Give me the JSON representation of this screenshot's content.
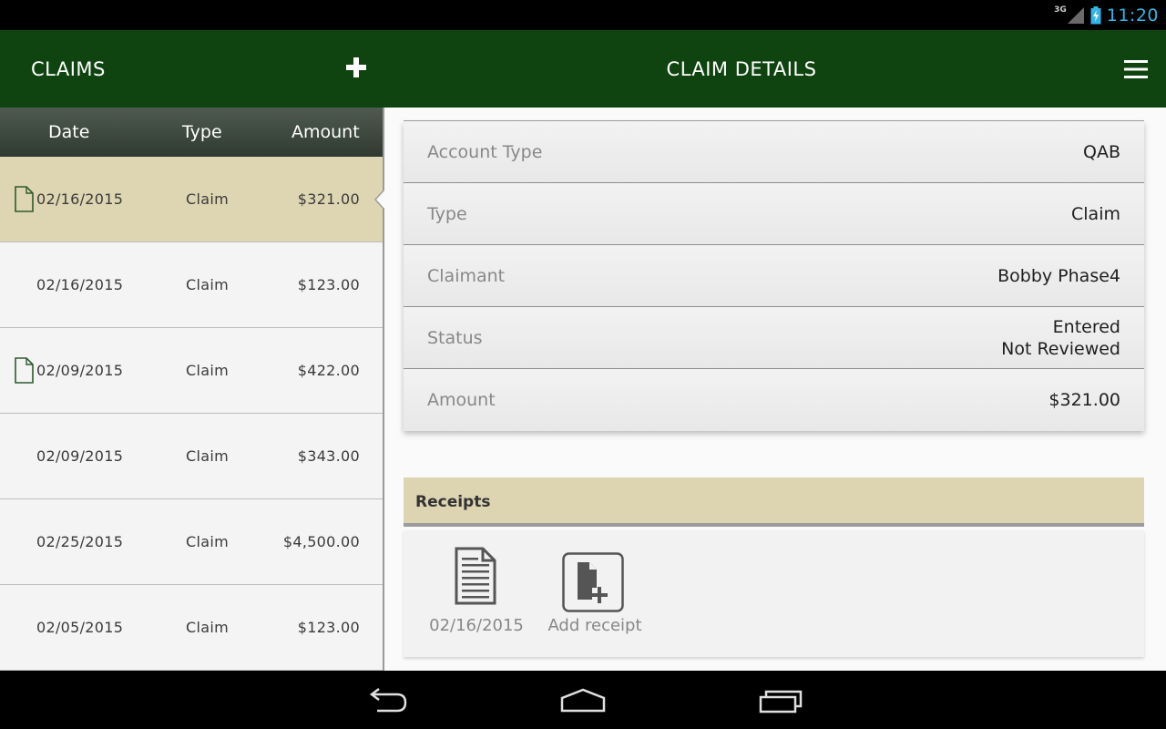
{
  "status_bar": {
    "network": "3G",
    "time": "11:20"
  },
  "action_bar": {
    "left_title": "CLAIMS",
    "center_title": "CLAIM DETAILS"
  },
  "claims_list": {
    "headers": {
      "date": "Date",
      "type": "Type",
      "amount": "Amount"
    },
    "rows": [
      {
        "date": "02/16/2015",
        "type": "Claim",
        "amount": "$321.00",
        "has_doc": true,
        "selected": true
      },
      {
        "date": "02/16/2015",
        "type": "Claim",
        "amount": "$123.00",
        "has_doc": false,
        "selected": false
      },
      {
        "date": "02/09/2015",
        "type": "Claim",
        "amount": "$422.00",
        "has_doc": true,
        "selected": false
      },
      {
        "date": "02/09/2015",
        "type": "Claim",
        "amount": "$343.00",
        "has_doc": false,
        "selected": false
      },
      {
        "date": "02/25/2015",
        "type": "Claim",
        "amount": "$4,500.00",
        "has_doc": false,
        "selected": false
      },
      {
        "date": "02/05/2015",
        "type": "Claim",
        "amount": "$123.00",
        "has_doc": false,
        "selected": false
      }
    ]
  },
  "details": {
    "account_type": {
      "label": "Account Type",
      "value": "QAB"
    },
    "type": {
      "label": "Type",
      "value": "Claim"
    },
    "claimant": {
      "label": "Claimant",
      "value": "Bobby Phase4"
    },
    "status": {
      "label": "Status",
      "value_line1": "Entered",
      "value_line2": "Not Reviewed"
    },
    "amount": {
      "label": "Amount",
      "value": "$321.00"
    }
  },
  "receipts": {
    "title": "Receipts",
    "items": [
      {
        "label": "02/16/2015",
        "icon": "receipt-document-icon"
      }
    ],
    "add_label": "Add receipt",
    "add_icon": "add-receipt-icon"
  },
  "colors": {
    "action_bar": "#0f4410",
    "selected_row": "#ded6b2",
    "receipts_header": "#ddd4b1",
    "clock": "#33b5e5",
    "doc_icon_stroke": "#2e5a2e"
  }
}
